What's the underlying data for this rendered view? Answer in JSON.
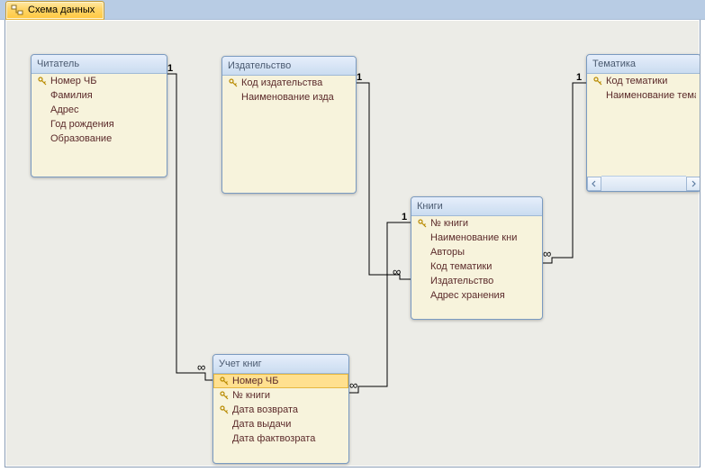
{
  "tab": {
    "title": "Схема данных"
  },
  "entities": {
    "reader": {
      "title": "Читатель",
      "fields": [
        {
          "label": "Номер ЧБ",
          "key": true
        },
        {
          "label": "Фамилия",
          "key": false
        },
        {
          "label": "Адрес",
          "key": false
        },
        {
          "label": "Год рождения",
          "key": false
        },
        {
          "label": "Образование",
          "key": false
        }
      ]
    },
    "publisher": {
      "title": "Издательство",
      "fields": [
        {
          "label": "Код издательства",
          "key": true
        },
        {
          "label": "Наименование изда",
          "key": false
        }
      ]
    },
    "topic": {
      "title": "Тематика",
      "fields": [
        {
          "label": "Код тематики",
          "key": true
        },
        {
          "label": "Наименование тема",
          "key": false
        }
      ]
    },
    "books": {
      "title": "Книги",
      "fields": [
        {
          "label": "№ книги",
          "key": true
        },
        {
          "label": "Наименование кни",
          "key": false
        },
        {
          "label": "Авторы",
          "key": false
        },
        {
          "label": "Код тематики",
          "key": false
        },
        {
          "label": "Издательство",
          "key": false
        },
        {
          "label": "Адрес хранения",
          "key": false
        }
      ]
    },
    "ledger": {
      "title": "Учет книг",
      "fields": [
        {
          "label": "Номер ЧБ",
          "key": true,
          "selected": true
        },
        {
          "label": "№ книги",
          "key": true
        },
        {
          "label": "Дата возврата",
          "key": true
        },
        {
          "label": "Дата выдачи",
          "key": false
        },
        {
          "label": "Дата фактвозрата",
          "key": false
        }
      ]
    }
  },
  "relationships": [
    {
      "from": "reader",
      "to": "ledger",
      "from_card": "1",
      "to_card": "∞"
    },
    {
      "from": "publisher",
      "to": "books",
      "from_card": "1",
      "to_card": "∞"
    },
    {
      "from": "topic",
      "to": "books",
      "from_card": "1",
      "to_card": "∞"
    },
    {
      "from": "books",
      "to": "ledger",
      "from_card": "1",
      "to_card": "∞"
    }
  ],
  "cardinality_labels": {
    "one": "1",
    "many": "∞"
  }
}
